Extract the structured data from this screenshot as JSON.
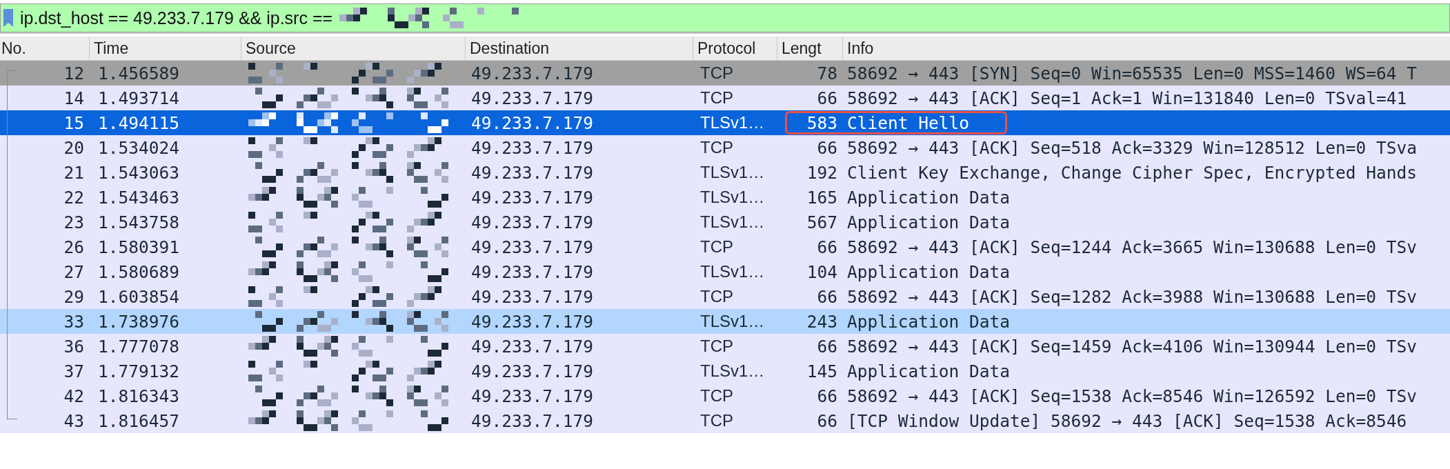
{
  "filter_bar": {
    "value": "ip.dst_host == 49.233.7.179 && ip.src ==",
    "valid": true
  },
  "table": {
    "columns": [
      "No.",
      "Time",
      "Source",
      "Destination",
      "Protocol",
      "Lengt",
      "Info"
    ],
    "rows": [
      {
        "no": "12",
        "time": "1.456589",
        "destination": "49.233.7.179",
        "protocol": "TCP",
        "length": "78",
        "info": "58692 → 443 [SYN] Seq=0 Win=65535 Len=0 MSS=1460 WS=64 T",
        "color": "#a0a0a0",
        "selected": false,
        "annotated": false
      },
      {
        "no": "14",
        "time": "1.493714",
        "destination": "49.233.7.179",
        "protocol": "TCP",
        "length": "66",
        "info": "58692 → 443 [ACK] Seq=1 Ack=1 Win=131840 Len=0 TSval=41",
        "color": "#e7e6ff",
        "selected": false,
        "annotated": false
      },
      {
        "no": "15",
        "time": "1.494115",
        "destination": "49.233.7.179",
        "protocol": "TLSv1…",
        "length": "583",
        "info": "Client Hello",
        "selected": true,
        "annotated": true
      },
      {
        "no": "20",
        "time": "1.534024",
        "destination": "49.233.7.179",
        "protocol": "TCP",
        "length": "66",
        "info": "58692 → 443 [ACK] Seq=518 Ack=3329 Win=128512 Len=0 TSva",
        "color": "#e7e6ff",
        "selected": false,
        "annotated": false
      },
      {
        "no": "21",
        "time": "1.543063",
        "destination": "49.233.7.179",
        "protocol": "TLSv1…",
        "length": "192",
        "info": "Client Key Exchange, Change Cipher Spec, Encrypted Hands",
        "color": "#e7e6ff",
        "selected": false,
        "annotated": false
      },
      {
        "no": "22",
        "time": "1.543463",
        "destination": "49.233.7.179",
        "protocol": "TLSv1…",
        "length": "165",
        "info": "Application Data",
        "color": "#e7e6ff",
        "selected": false,
        "annotated": false
      },
      {
        "no": "23",
        "time": "1.543758",
        "destination": "49.233.7.179",
        "protocol": "TLSv1…",
        "length": "567",
        "info": "Application Data",
        "color": "#e7e6ff",
        "selected": false,
        "annotated": false
      },
      {
        "no": "26",
        "time": "1.580391",
        "destination": "49.233.7.179",
        "protocol": "TCP",
        "length": "66",
        "info": "58692 → 443 [ACK] Seq=1244 Ack=3665 Win=130688 Len=0 TSv",
        "color": "#e7e6ff",
        "selected": false,
        "annotated": false
      },
      {
        "no": "27",
        "time": "1.580689",
        "destination": "49.233.7.179",
        "protocol": "TLSv1…",
        "length": "104",
        "info": "Application Data",
        "color": "#e7e6ff",
        "selected": false,
        "annotated": false
      },
      {
        "no": "29",
        "time": "1.603854",
        "destination": "49.233.7.179",
        "protocol": "TCP",
        "length": "66",
        "info": "58692 → 443 [ACK] Seq=1282 Ack=3988 Win=130688 Len=0 TSv",
        "color": "#e7e6ff",
        "selected": false,
        "annotated": false
      },
      {
        "no": "33",
        "time": "1.738976",
        "destination": "49.233.7.179",
        "protocol": "TLSv1…",
        "length": "243",
        "info": "Application Data",
        "color": "#b3d6ff",
        "selected": false,
        "annotated": false
      },
      {
        "no": "36",
        "time": "1.777078",
        "destination": "49.233.7.179",
        "protocol": "TCP",
        "length": "66",
        "info": "58692 → 443 [ACK] Seq=1459 Ack=4106 Win=130944 Len=0 TSv",
        "color": "#e7e6ff",
        "selected": false,
        "annotated": false
      },
      {
        "no": "37",
        "time": "1.779132",
        "destination": "49.233.7.179",
        "protocol": "TLSv1…",
        "length": "145",
        "info": "Application Data",
        "color": "#e7e6ff",
        "selected": false,
        "annotated": false
      },
      {
        "no": "42",
        "time": "1.816343",
        "destination": "49.233.7.179",
        "protocol": "TCP",
        "length": "66",
        "info": "58692 → 443 [ACK] Seq=1538 Ack=8546 Win=126592 Len=0 TSv",
        "color": "#e7e6ff",
        "selected": false,
        "annotated": false
      },
      {
        "no": "43",
        "time": "1.816457",
        "destination": "49.233.7.179",
        "protocol": "TCP",
        "length": "66",
        "info": "[TCP Window Update] 58692 → 443 [ACK] Seq=1538 Ack=8546",
        "color": "#e7e6ff",
        "selected": false,
        "annotated": false
      }
    ]
  }
}
